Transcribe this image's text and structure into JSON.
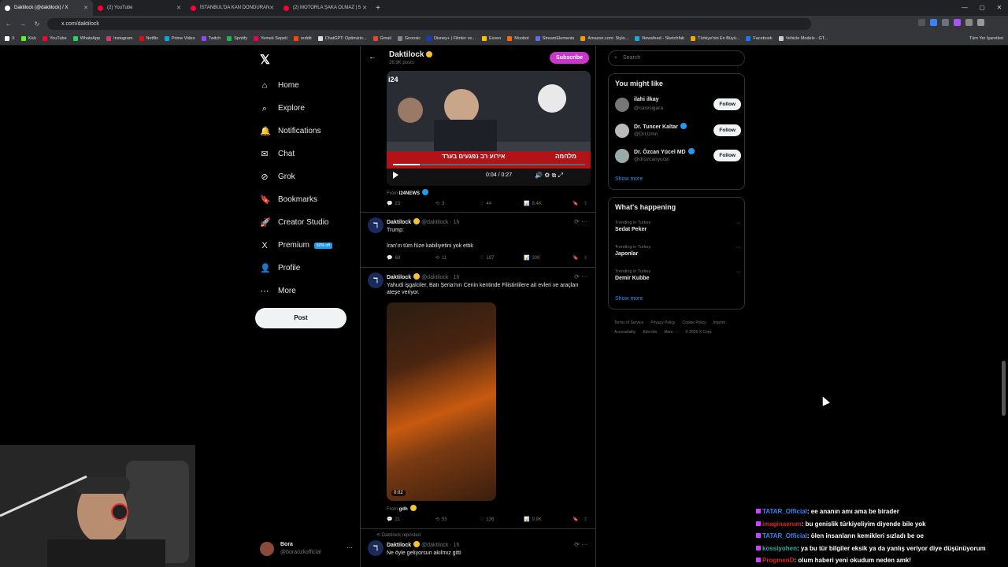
{
  "browser": {
    "tabs": [
      {
        "label": "Daktilock (@daktilock) / X",
        "color": "#ffffff",
        "active": true
      },
      {
        "label": "(2) YouTube",
        "color": "#ff0033",
        "active": false
      },
      {
        "label": "İSTANBUL'DA KAN DONDURAN",
        "color": "#ff0033",
        "active": false
      },
      {
        "label": "(2) MOTORLA ŞAKA OLMAZ | 5",
        "color": "#ff0033",
        "active": false
      }
    ],
    "url": "x.com/daktilock",
    "bookmarks": [
      {
        "label": "X",
        "color": "#ffffff"
      },
      {
        "label": "Kick",
        "color": "#53fc18"
      },
      {
        "label": "YouTube",
        "color": "#ff0033"
      },
      {
        "label": "WhatsApp",
        "color": "#25d366"
      },
      {
        "label": "Instagram",
        "color": "#e1306c"
      },
      {
        "label": "Netflix",
        "color": "#e50914"
      },
      {
        "label": "Prime Video",
        "color": "#00a8e1"
      },
      {
        "label": "Twitch",
        "color": "#9146ff"
      },
      {
        "label": "Spotify",
        "color": "#1db954"
      },
      {
        "label": "Yemek Sepeti",
        "color": "#ea004b"
      },
      {
        "label": "reddit",
        "color": "#ff4500"
      },
      {
        "label": "ChatGPT: Optimizin...",
        "color": "#dddddd"
      },
      {
        "label": "Gmail",
        "color": "#ea4335"
      },
      {
        "label": "Gnoosic",
        "color": "#888888"
      },
      {
        "label": "Disney+ | Filmler ve...",
        "color": "#113ccf"
      },
      {
        "label": "Exxen",
        "color": "#f7c600"
      },
      {
        "label": "Moobot",
        "color": "#ff6a00"
      },
      {
        "label": "StreamElements",
        "color": "#5d6bf2"
      },
      {
        "label": "Amazon.com: Stylo...",
        "color": "#ff9900"
      },
      {
        "label": "Newsfeed - Sketchfab",
        "color": "#1caad9"
      },
      {
        "label": "Türkiye'nin En Büyü...",
        "color": "#f9a602"
      },
      {
        "label": "Facebook",
        "color": "#1877f2"
      },
      {
        "label": "Vehicle Models - GT...",
        "color": "#cccccc"
      }
    ],
    "bookmarks_end": "Tüm Yer İşaretleri"
  },
  "sidebar": {
    "items": [
      {
        "label": "Home",
        "icon": "⌂"
      },
      {
        "label": "Explore",
        "icon": "⌕"
      },
      {
        "label": "Notifications",
        "icon": "🔔"
      },
      {
        "label": "Chat",
        "icon": "✉"
      },
      {
        "label": "Grok",
        "icon": "⊘"
      },
      {
        "label": "Bookmarks",
        "icon": "🔖"
      },
      {
        "label": "Creator Studio",
        "icon": "🚀"
      },
      {
        "label": "Premium",
        "icon": "X",
        "badge": "50% off"
      },
      {
        "label": "Profile",
        "icon": "👤"
      },
      {
        "label": "More",
        "icon": "⋯"
      }
    ],
    "post_label": "Post",
    "account": {
      "name": "Bora",
      "handle": "@boraozkofficial"
    }
  },
  "feed": {
    "header": {
      "name": "Daktilock",
      "posts": "26.9K posts",
      "subscribe": "Subscribe"
    },
    "video1": {
      "time": "0:04 / 0:27",
      "overlay_text_1": "אירוע רב נפגעים בערד",
      "overlay_text_2": "מלחמה",
      "from_label": "From",
      "from_name": "I24NEWS"
    },
    "actions1": {
      "replies": "23",
      "reposts": "3",
      "likes": "44",
      "views": "8.4K"
    },
    "tweet1": {
      "name": "Daktilock",
      "handle": "@daktilock · 1h",
      "line1": "Trump:",
      "line2": "İran'ın tüm füze kabiliyetini yok ettik"
    },
    "actions2": {
      "replies": "68",
      "reposts": "11",
      "likes": "187",
      "views": "30K"
    },
    "tweet2": {
      "name": "Daktilock",
      "handle": "@daktilock · 1h",
      "text": "Yahudi işgalciler, Batı Şeria'nın Cenin kentinde Filistinlilere ait evleri ve araçları ateşe veriyor.",
      "video_duration": "0:02",
      "from_label": "From",
      "from_name": "gdh"
    },
    "actions3": {
      "replies": "21",
      "reposts": "55",
      "likes": "136",
      "views": "9.9K"
    },
    "tweet3": {
      "repost_label": "Daktilock reposted",
      "name": "Daktilock",
      "handle": "@daktilock · 1h",
      "text": "Ne öyle geliyorsun akılmız gitti"
    }
  },
  "right": {
    "search_placeholder": "Search",
    "might_like": {
      "title": "You might like",
      "users": [
        {
          "name": "ilahi ilkay",
          "handle": "@caresigara",
          "verified": false
        },
        {
          "name": "Dr. Tuncer Kaltar",
          "handle": "@DrUzmn",
          "verified": true
        },
        {
          "name": "Dr. Özcan Yücel MD",
          "handle": "@drozcanyucel",
          "verified": true
        }
      ],
      "follow_label": "Follow",
      "show_more": "Show more"
    },
    "happening": {
      "title": "What's happening",
      "trends": [
        {
          "context": "Trending in Turkey",
          "topic": "Sedat Peker"
        },
        {
          "context": "Trending in Turkey",
          "topic": "Japonlar"
        },
        {
          "context": "Trending in Turkey",
          "topic": "Demir Kubbe"
        }
      ],
      "show_more": "Show more"
    },
    "footer": [
      "Terms of Service",
      "Privacy Policy",
      "Cookie Policy",
      "Imprint",
      "Accessibility",
      "Ads info",
      "More ···",
      "© 2026 X Corp."
    ]
  },
  "chat": [
    {
      "user": "TATAR_Official",
      "msg": ": ee ananın amı ama be birader",
      "color": "blue"
    },
    {
      "user": "imaginaerum",
      "msg": ": bu genislik türkiyeliyim diyende bile yok",
      "color": "red"
    },
    {
      "user": "TATAR_Official",
      "msg": ": ölen insanların kemikleri sızladı be oe",
      "color": "blue"
    },
    {
      "user": "kossiyohen",
      "msg": ": ya bu tür bilgiler eksik ya da yanlış veriyor diye düşünüyorum",
      "color": "teal"
    },
    {
      "user": "ProgmenD",
      "msg": ": olum haberi yeni okudum neden amk!",
      "color": "red"
    }
  ]
}
